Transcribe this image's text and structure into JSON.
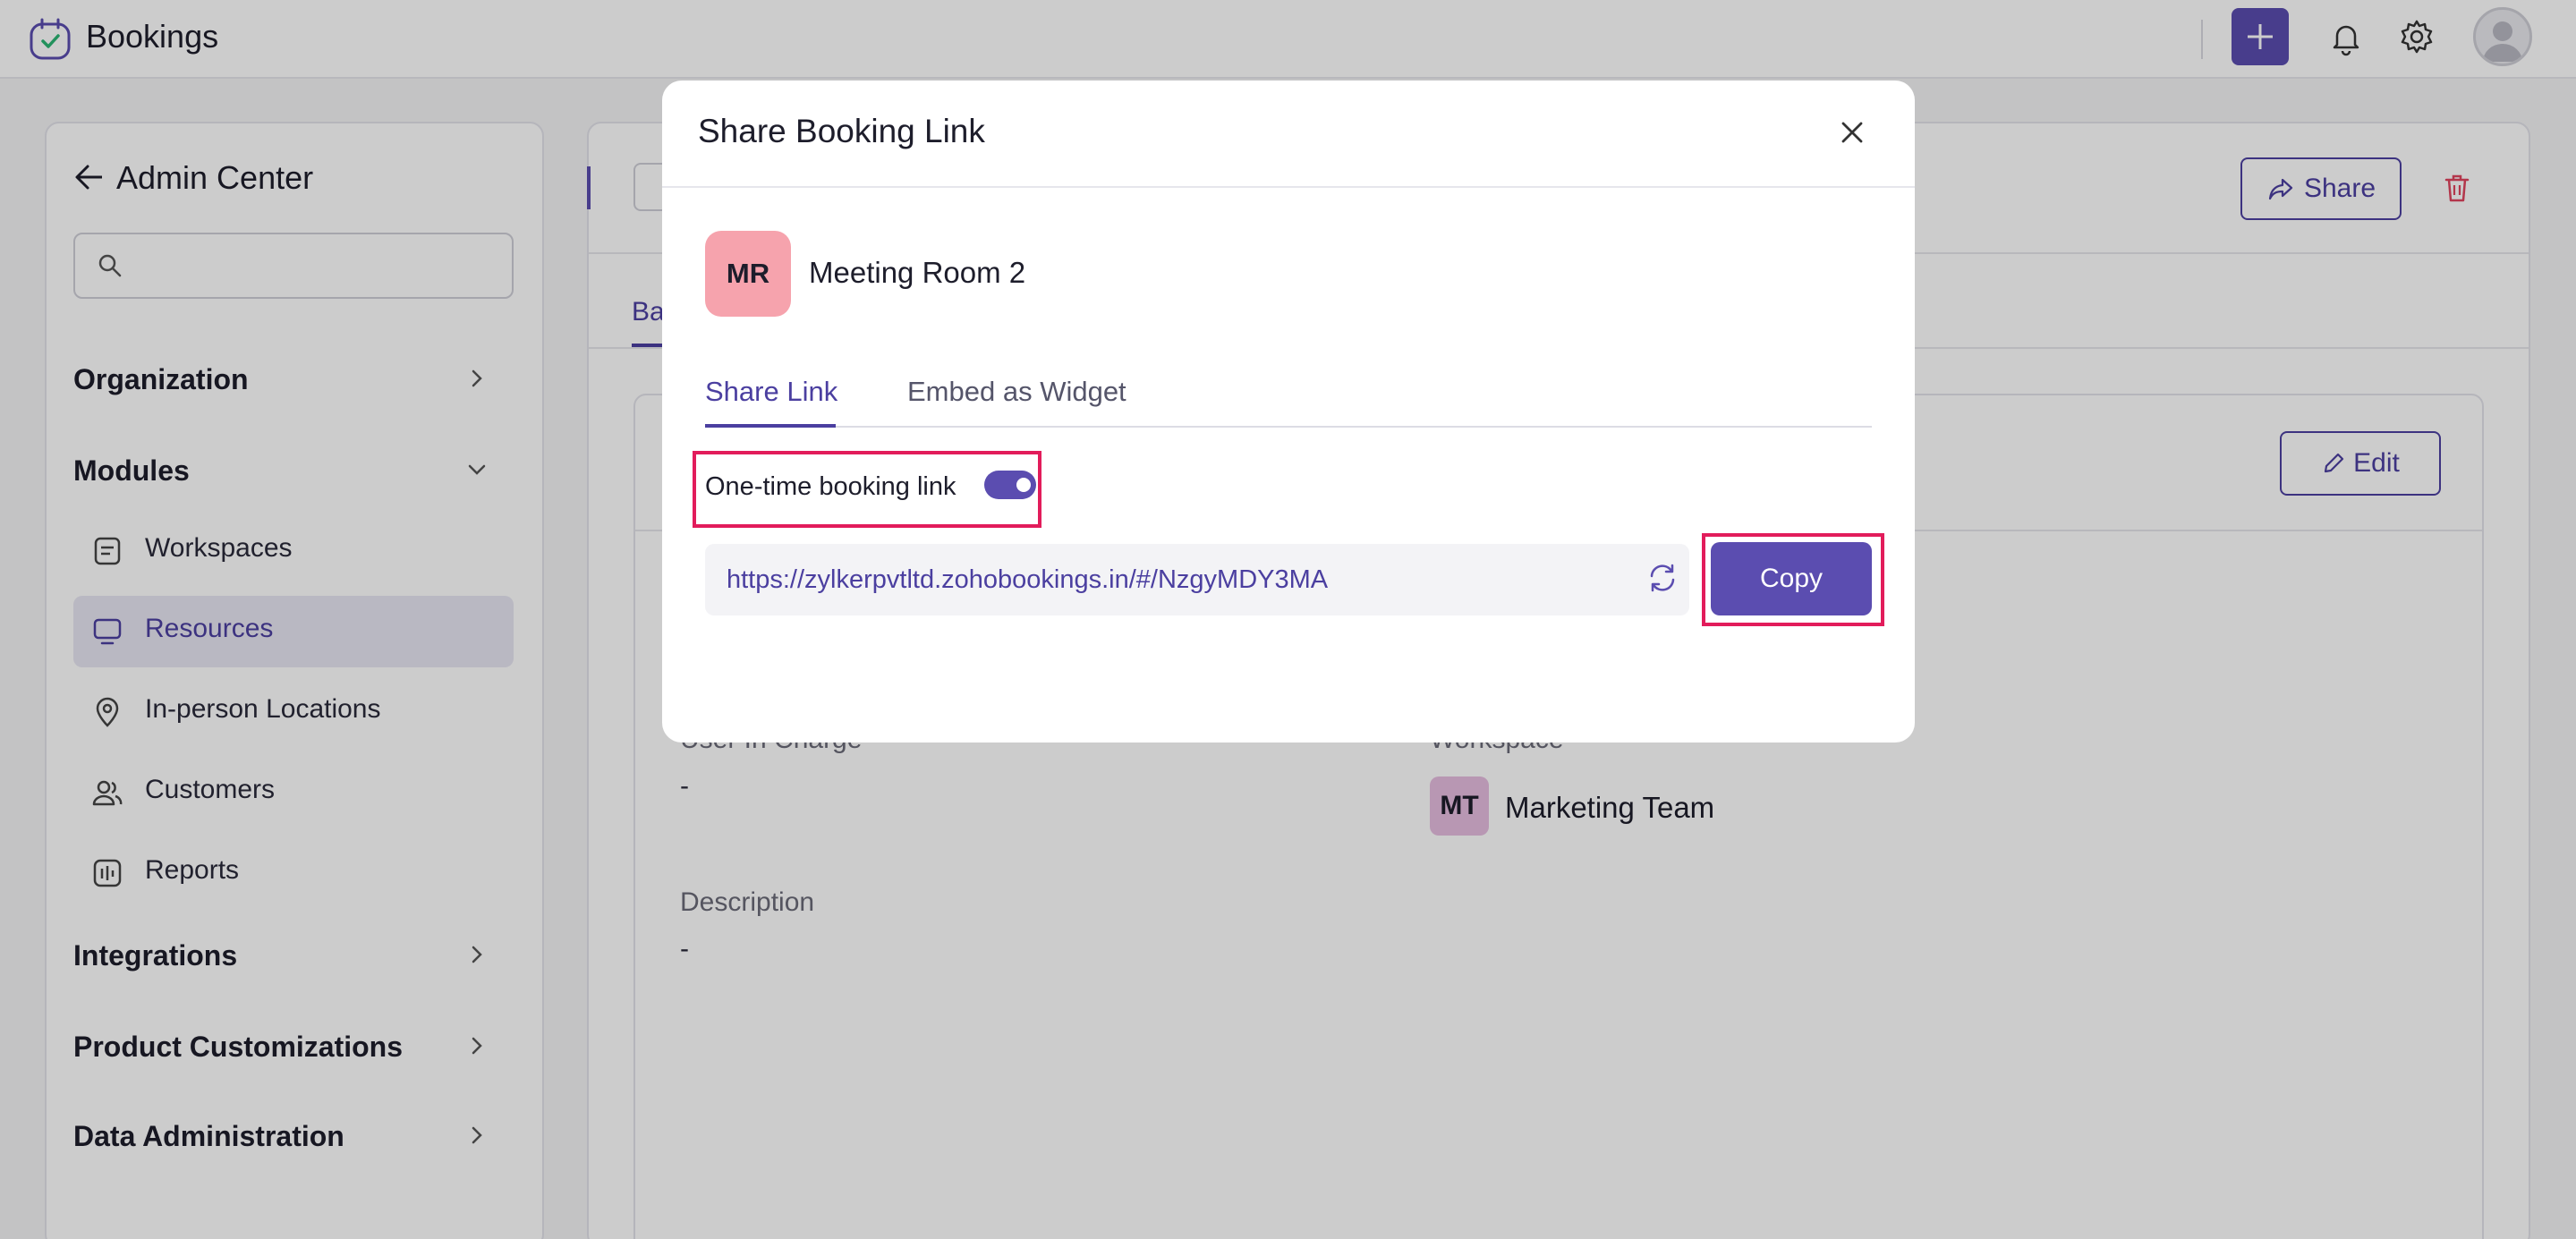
{
  "app": {
    "title": "Bookings"
  },
  "sidebar": {
    "title": "Admin Center",
    "search_placeholder": "",
    "groups": {
      "organization": "Organization",
      "modules": "Modules",
      "integrations": "Integrations",
      "product_customizations": "Product Customizations",
      "data_administration": "Data Administration"
    },
    "items": [
      {
        "label": "Workspaces",
        "icon": "workspace-icon"
      },
      {
        "label": "Resources",
        "icon": "monitor-icon",
        "active": true
      },
      {
        "label": "In-person Locations",
        "icon": "location-pin-icon"
      },
      {
        "label": "Customers",
        "icon": "users-icon"
      },
      {
        "label": "Reports",
        "icon": "reports-icon"
      }
    ]
  },
  "main": {
    "share_label": "Share",
    "tab_partial": "Ba",
    "edit_label": "Edit",
    "fields": {
      "user_in_charge_label": "User In Charge",
      "user_in_charge_value": "-",
      "workspace_label": "Workspace",
      "workspace_initials": "MT",
      "workspace_name": "Marketing Team",
      "description_label": "Description",
      "description_value": "-"
    }
  },
  "modal": {
    "title": "Share Booking Link",
    "resource_initials": "MR",
    "resource_name": "Meeting Room 2",
    "tabs": [
      "Share Link",
      "Embed as Widget"
    ],
    "active_tab": "Share Link",
    "one_time_label": "One-time booking link",
    "one_time_enabled": true,
    "link": "https://zylkerpvtltd.zohobookings.in/#/NzgyMDY3MA",
    "copy_label": "Copy"
  },
  "colors": {
    "accent": "#5b4db0",
    "highlight": "#e21c5b",
    "resource_avatar": "#f6a3ad",
    "workspace_avatar": "#e7bde0"
  }
}
